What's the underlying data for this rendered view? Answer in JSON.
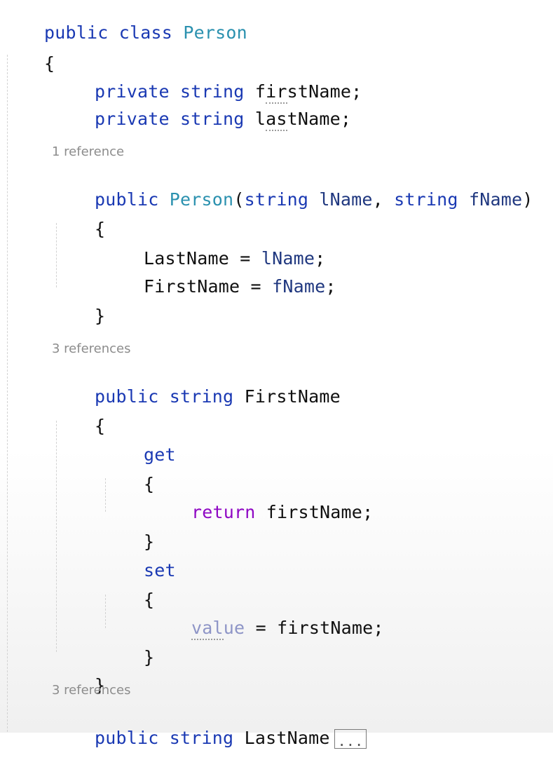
{
  "code": {
    "class_decl": {
      "kw1": "public",
      "kw2": "class",
      "name": "Person"
    },
    "brace_open": "{",
    "brace_close": "}",
    "field1": {
      "kw1": "private",
      "kw2": "string",
      "name_lead": "f",
      "name_squig": "ir",
      "name_rest": "stName",
      "semi": ";"
    },
    "field2": {
      "kw1": "private",
      "kw2": "string",
      "name_lead": "l",
      "name_squig": "as",
      "name_rest": "tName",
      "semi": ";"
    },
    "lens1": "1 reference",
    "ctor": {
      "kw": "public",
      "name": "Person",
      "open": "(",
      "t1": "string",
      "p1": "lName",
      "comma": ",",
      "t2": "string",
      "p2": "fName",
      "close": ")"
    },
    "ctor_body1": {
      "left": "LastName",
      "eq": "=",
      "right": "lName",
      "semi": ";"
    },
    "ctor_body2": {
      "left": "FirstName",
      "eq": "=",
      "right": "fName",
      "semi": ";"
    },
    "lens2": "3 references",
    "prop1": {
      "kw1": "public",
      "kw2": "string",
      "name": "FirstName"
    },
    "get_kw": "get",
    "return_line": {
      "kw": "return",
      "value": "firstName",
      "semi": ";"
    },
    "set_kw": "set",
    "value_line": {
      "kw_squig": "val",
      "kw_rest": "ue",
      "eq": "=",
      "value": "firstName",
      "semi": ";"
    },
    "lens3": "3 references",
    "prop2": {
      "kw1": "public",
      "kw2": "string",
      "name": "LastName",
      "collapsed": "..."
    }
  }
}
